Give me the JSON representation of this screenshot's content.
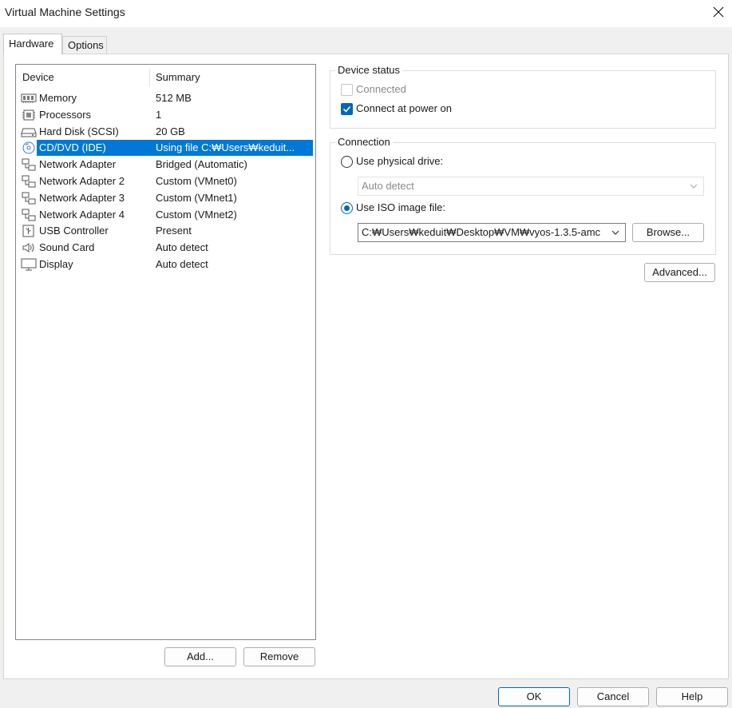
{
  "window": {
    "title": "Virtual Machine Settings"
  },
  "tabs": [
    {
      "label": "Hardware",
      "active": true
    },
    {
      "label": "Options",
      "active": false
    }
  ],
  "device_list": {
    "columns": [
      "Device",
      "Summary"
    ],
    "rows": [
      {
        "icon": "memory-icon",
        "device": "Memory",
        "summary": "512 MB"
      },
      {
        "icon": "processor-icon",
        "device": "Processors",
        "summary": "1"
      },
      {
        "icon": "hard-disk-icon",
        "device": "Hard Disk (SCSI)",
        "summary": "20 GB"
      },
      {
        "icon": "cd-dvd-icon",
        "device": "CD/DVD (IDE)",
        "summary": "Using file C:₩Users₩keduit...",
        "selected": true
      },
      {
        "icon": "network-adapter-icon",
        "device": "Network Adapter",
        "summary": "Bridged (Automatic)"
      },
      {
        "icon": "network-adapter-icon",
        "device": "Network Adapter 2",
        "summary": "Custom (VMnet0)"
      },
      {
        "icon": "network-adapter-icon",
        "device": "Network Adapter 3",
        "summary": "Custom (VMnet1)"
      },
      {
        "icon": "network-adapter-icon",
        "device": "Network Adapter 4",
        "summary": "Custom (VMnet2)"
      },
      {
        "icon": "usb-controller-icon",
        "device": "USB Controller",
        "summary": "Present"
      },
      {
        "icon": "sound-card-icon",
        "device": "Sound Card",
        "summary": "Auto detect"
      },
      {
        "icon": "display-icon",
        "device": "Display",
        "summary": "Auto detect"
      }
    ]
  },
  "list_buttons": {
    "add": "Add...",
    "remove": "Remove"
  },
  "device_status": {
    "legend": "Device status",
    "connected": {
      "label": "Connected",
      "checked": false,
      "disabled": true
    },
    "connect_at_power_on": {
      "label": "Connect at power on",
      "checked": true
    }
  },
  "connection": {
    "legend": "Connection",
    "physical_drive": {
      "label": "Use physical drive:",
      "selected": false
    },
    "physical_drive_value": "Auto detect",
    "iso_image": {
      "label": "Use ISO image file:",
      "selected": true
    },
    "iso_path": "C:₩Users₩keduit₩Desktop₩VM₩vyos-1.3.5-amc",
    "browse": "Browse..."
  },
  "advanced_button": "Advanced...",
  "footer": {
    "ok": "OK",
    "cancel": "Cancel",
    "help": "Help"
  },
  "colors": {
    "accent": "#0078d7",
    "selection": "#0078d7"
  }
}
